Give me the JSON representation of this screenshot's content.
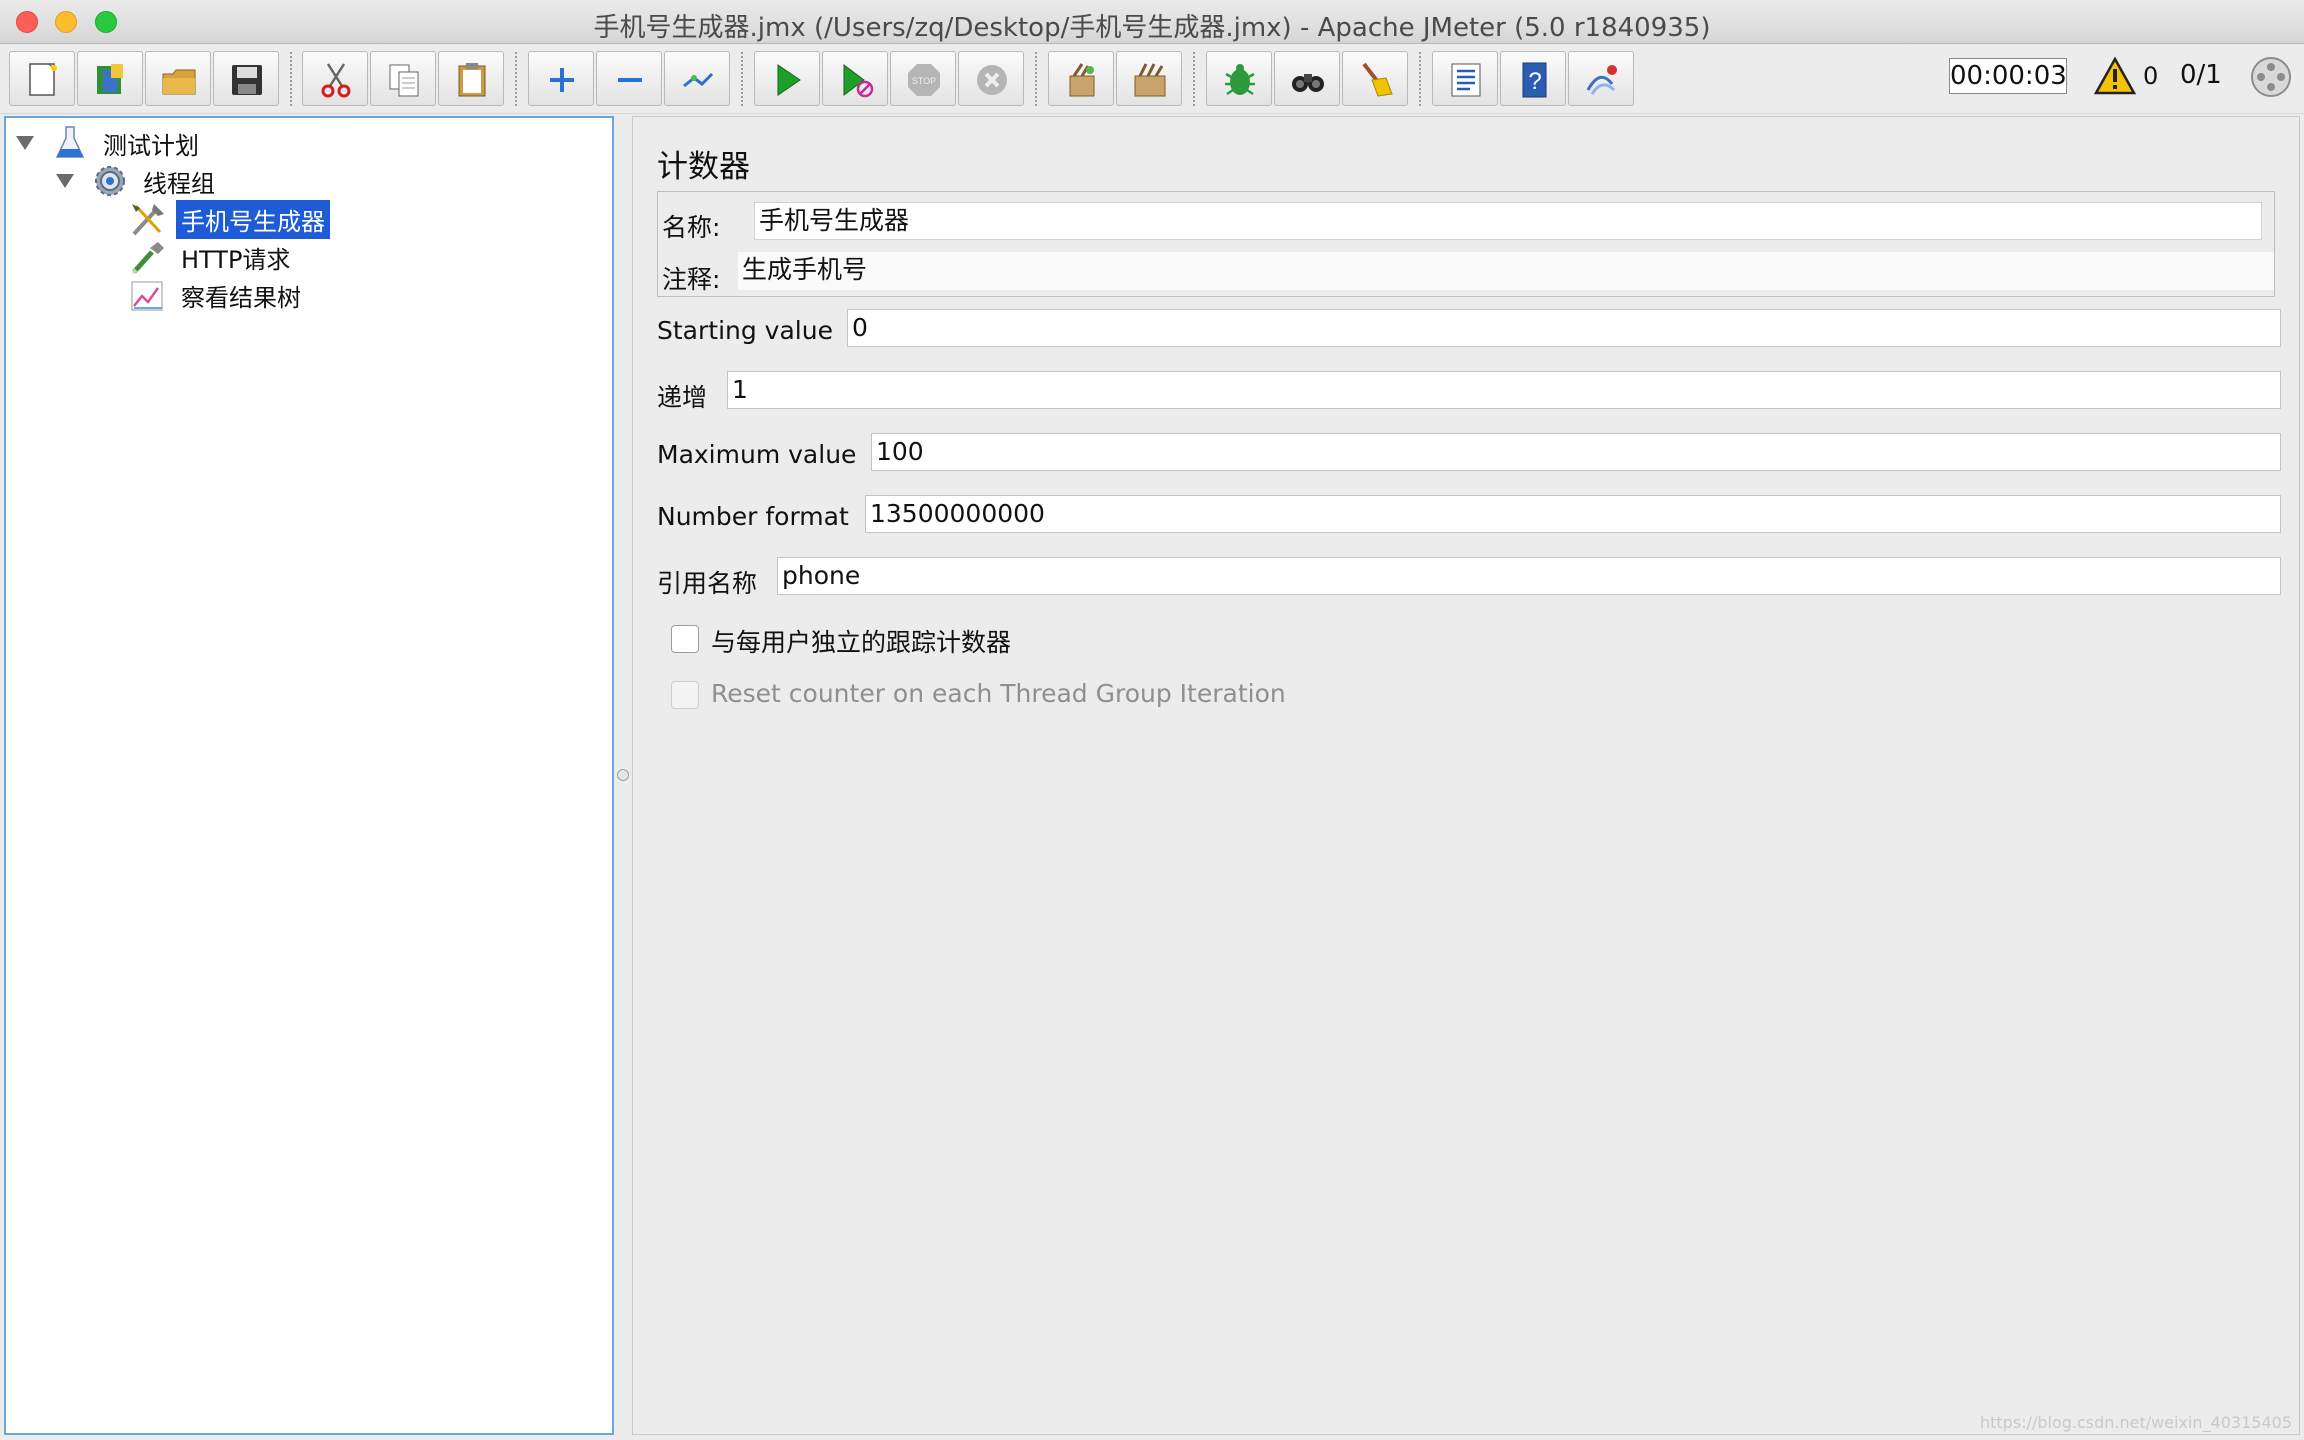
{
  "window": {
    "title": "手机号生成器.jmx (/Users/zq/Desktop/手机号生成器.jmx) - Apache JMeter (5.0 r1840935)"
  },
  "toolbar": {
    "buttons": [
      {
        "name": "new-icon"
      },
      {
        "name": "templates-icon"
      },
      {
        "name": "open-icon"
      },
      {
        "name": "save-icon"
      },
      {
        "name": "cut-icon"
      },
      {
        "name": "copy-icon"
      },
      {
        "name": "paste-icon"
      },
      {
        "name": "expand-icon"
      },
      {
        "name": "collapse-icon"
      },
      {
        "name": "toggle-icon"
      },
      {
        "name": "start-icon"
      },
      {
        "name": "start-no-pauses-icon"
      },
      {
        "name": "stop-icon"
      },
      {
        "name": "shutdown-icon"
      },
      {
        "name": "clear-icon"
      },
      {
        "name": "clear-all-icon"
      },
      {
        "name": "function-helper-icon"
      },
      {
        "name": "search-icon"
      },
      {
        "name": "reset-search-icon"
      },
      {
        "name": "log-viewer-icon"
      },
      {
        "name": "help-icon"
      },
      {
        "name": "remote-icon"
      }
    ],
    "timer": "00:00:03",
    "warning_count": "0",
    "threads": "0/1"
  },
  "tree": {
    "nodes": [
      {
        "label": "测试计划",
        "icon": "test-plan-icon",
        "level": 0,
        "expanded": true
      },
      {
        "label": "线程组",
        "icon": "thread-group-icon",
        "level": 1,
        "expanded": true
      },
      {
        "label": "手机号生成器",
        "icon": "counter-icon",
        "level": 2,
        "selected": true
      },
      {
        "label": "HTTP请求",
        "icon": "http-sampler-icon",
        "level": 2
      },
      {
        "label": "察看结果树",
        "icon": "results-tree-icon",
        "level": 2
      }
    ]
  },
  "editor": {
    "title": "计数器",
    "name_label": "名称:",
    "name_value": "手机号生成器",
    "comment_label": "注释:",
    "comment_value": "生成手机号",
    "starting_label": "Starting value",
    "starting_value": "0",
    "increment_label": "递增",
    "increment_value": "1",
    "max_label": "Maximum value",
    "max_value": "100",
    "format_label": "Number format",
    "format_value": "13500000000",
    "ref_label": "引用名称",
    "ref_value": "phone",
    "per_user_label": "与每用户独立的跟踪计数器",
    "per_user_checked": false,
    "reset_label": "Reset counter on each Thread Group Iteration",
    "reset_checked": false
  },
  "watermark": "https://blog.csdn.net/weixin_40315405"
}
